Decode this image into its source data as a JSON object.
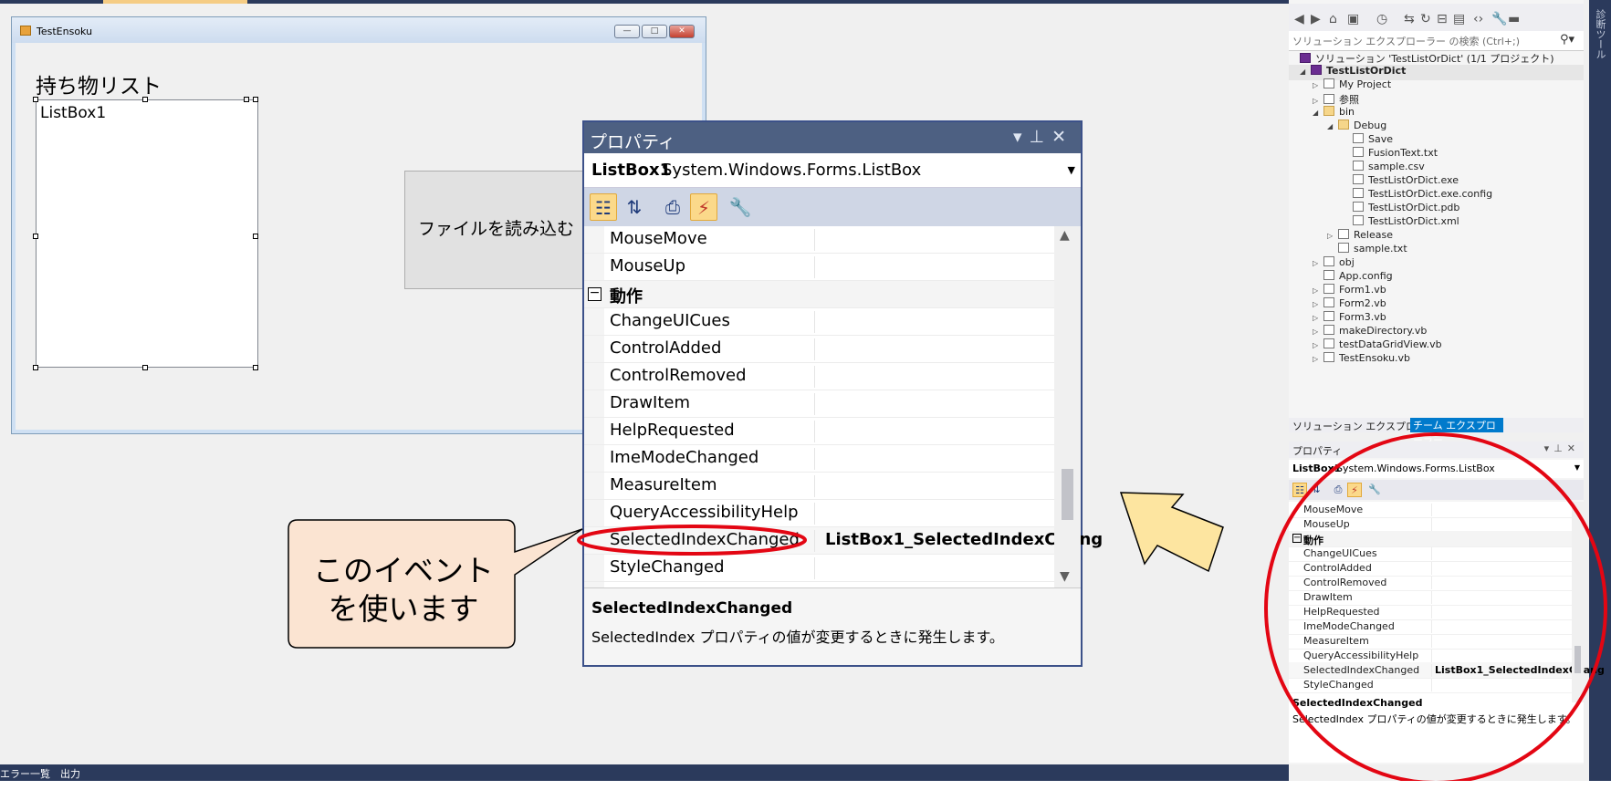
{
  "form": {
    "title": "TestEnsoku",
    "list_label": "持ち物リスト",
    "listbox_text": "ListBox1",
    "file_button": "ファイルを読み込む"
  },
  "properties": {
    "title": "プロパティ",
    "object_name": "ListBox1",
    "object_type": "System.Windows.Forms.ListBox",
    "rows_before": [
      "MouseMove",
      "MouseUp"
    ],
    "category": "動作",
    "rows_after": [
      {
        "name": "ChangeUICues",
        "value": ""
      },
      {
        "name": "ControlAdded",
        "value": ""
      },
      {
        "name": "ControlRemoved",
        "value": ""
      },
      {
        "name": "DrawItem",
        "value": ""
      },
      {
        "name": "HelpRequested",
        "value": ""
      },
      {
        "name": "ImeModeChanged",
        "value": ""
      },
      {
        "name": "MeasureItem",
        "value": ""
      },
      {
        "name": "QueryAccessibilityHelp",
        "value": ""
      },
      {
        "name": "SelectedIndexChanged",
        "value": "ListBox1_SelectedIndexChang"
      },
      {
        "name": "StyleChanged",
        "value": ""
      }
    ],
    "description_title": "SelectedIndexChanged",
    "description_text": "SelectedIndex プロパティの値が変更するときに発生します。"
  },
  "callout": {
    "line1": "このイベント",
    "line2": "を使います",
    "fill_color": "#fbe4d2",
    "ellipse_color": "#e30613"
  },
  "arrow": {
    "fill_color": "#fde5a0"
  },
  "solution_explorer": {
    "search_placeholder": "ソリューション エクスプローラー の検索 (Ctrl+;)",
    "solution_label": "ソリューション 'TestListOrDict' (1/1 プロジェクト)",
    "project": "TestListOrDict",
    "items": {
      "my_project": "My Project",
      "references": "参照",
      "bin": "bin",
      "debug": "Debug",
      "save": "Save",
      "fusion": "FusionText.txt",
      "sample_csv": "sample.csv",
      "exe": "TestListOrDict.exe",
      "exe_config": "TestListOrDict.exe.config",
      "pdb": "TestListOrDict.pdb",
      "xml": "TestListOrDict.xml",
      "release": "Release",
      "sample_txt": "sample.txt",
      "obj": "obj",
      "app_config": "App.config",
      "form1": "Form1.vb",
      "form2": "Form2.vb",
      "form3": "Form3.vb",
      "make_dir": "makeDirectory.vb",
      "test_dgv": "testDataGridView.vb",
      "test_ensoku": "TestEnsoku.vb"
    },
    "tab1": "ソリューション エクスプローラー",
    "tab2": "チーム エクスプローラー"
  },
  "side_strip": "診断ツール",
  "bottom": {
    "tabs": "エラー一覧　出力"
  }
}
